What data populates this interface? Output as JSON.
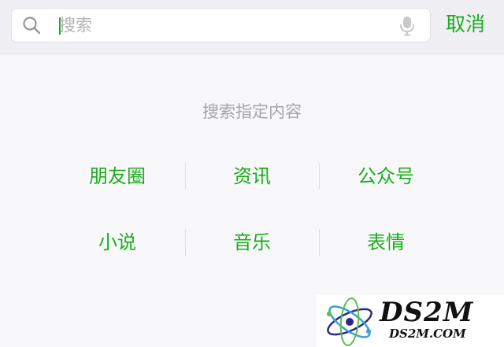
{
  "search": {
    "placeholder": "搜索",
    "cancel_label": "取消"
  },
  "hint": {
    "title": "搜索指定内容"
  },
  "categories": {
    "row1": [
      "朋友圈",
      "资讯",
      "公众号"
    ],
    "row2": [
      "小说",
      "音乐",
      "表情"
    ]
  },
  "watermark": {
    "main": "DS2M",
    "sub": "DS2M.COM"
  },
  "colors": {
    "accent": "#1aad19",
    "hint_text": "#a5a5a8",
    "top_bar_bg": "#efeff4",
    "page_bg": "#f8f8fa"
  },
  "icons": {
    "search": "search-icon",
    "microphone": "microphone-icon",
    "logo": "atom-logo"
  }
}
